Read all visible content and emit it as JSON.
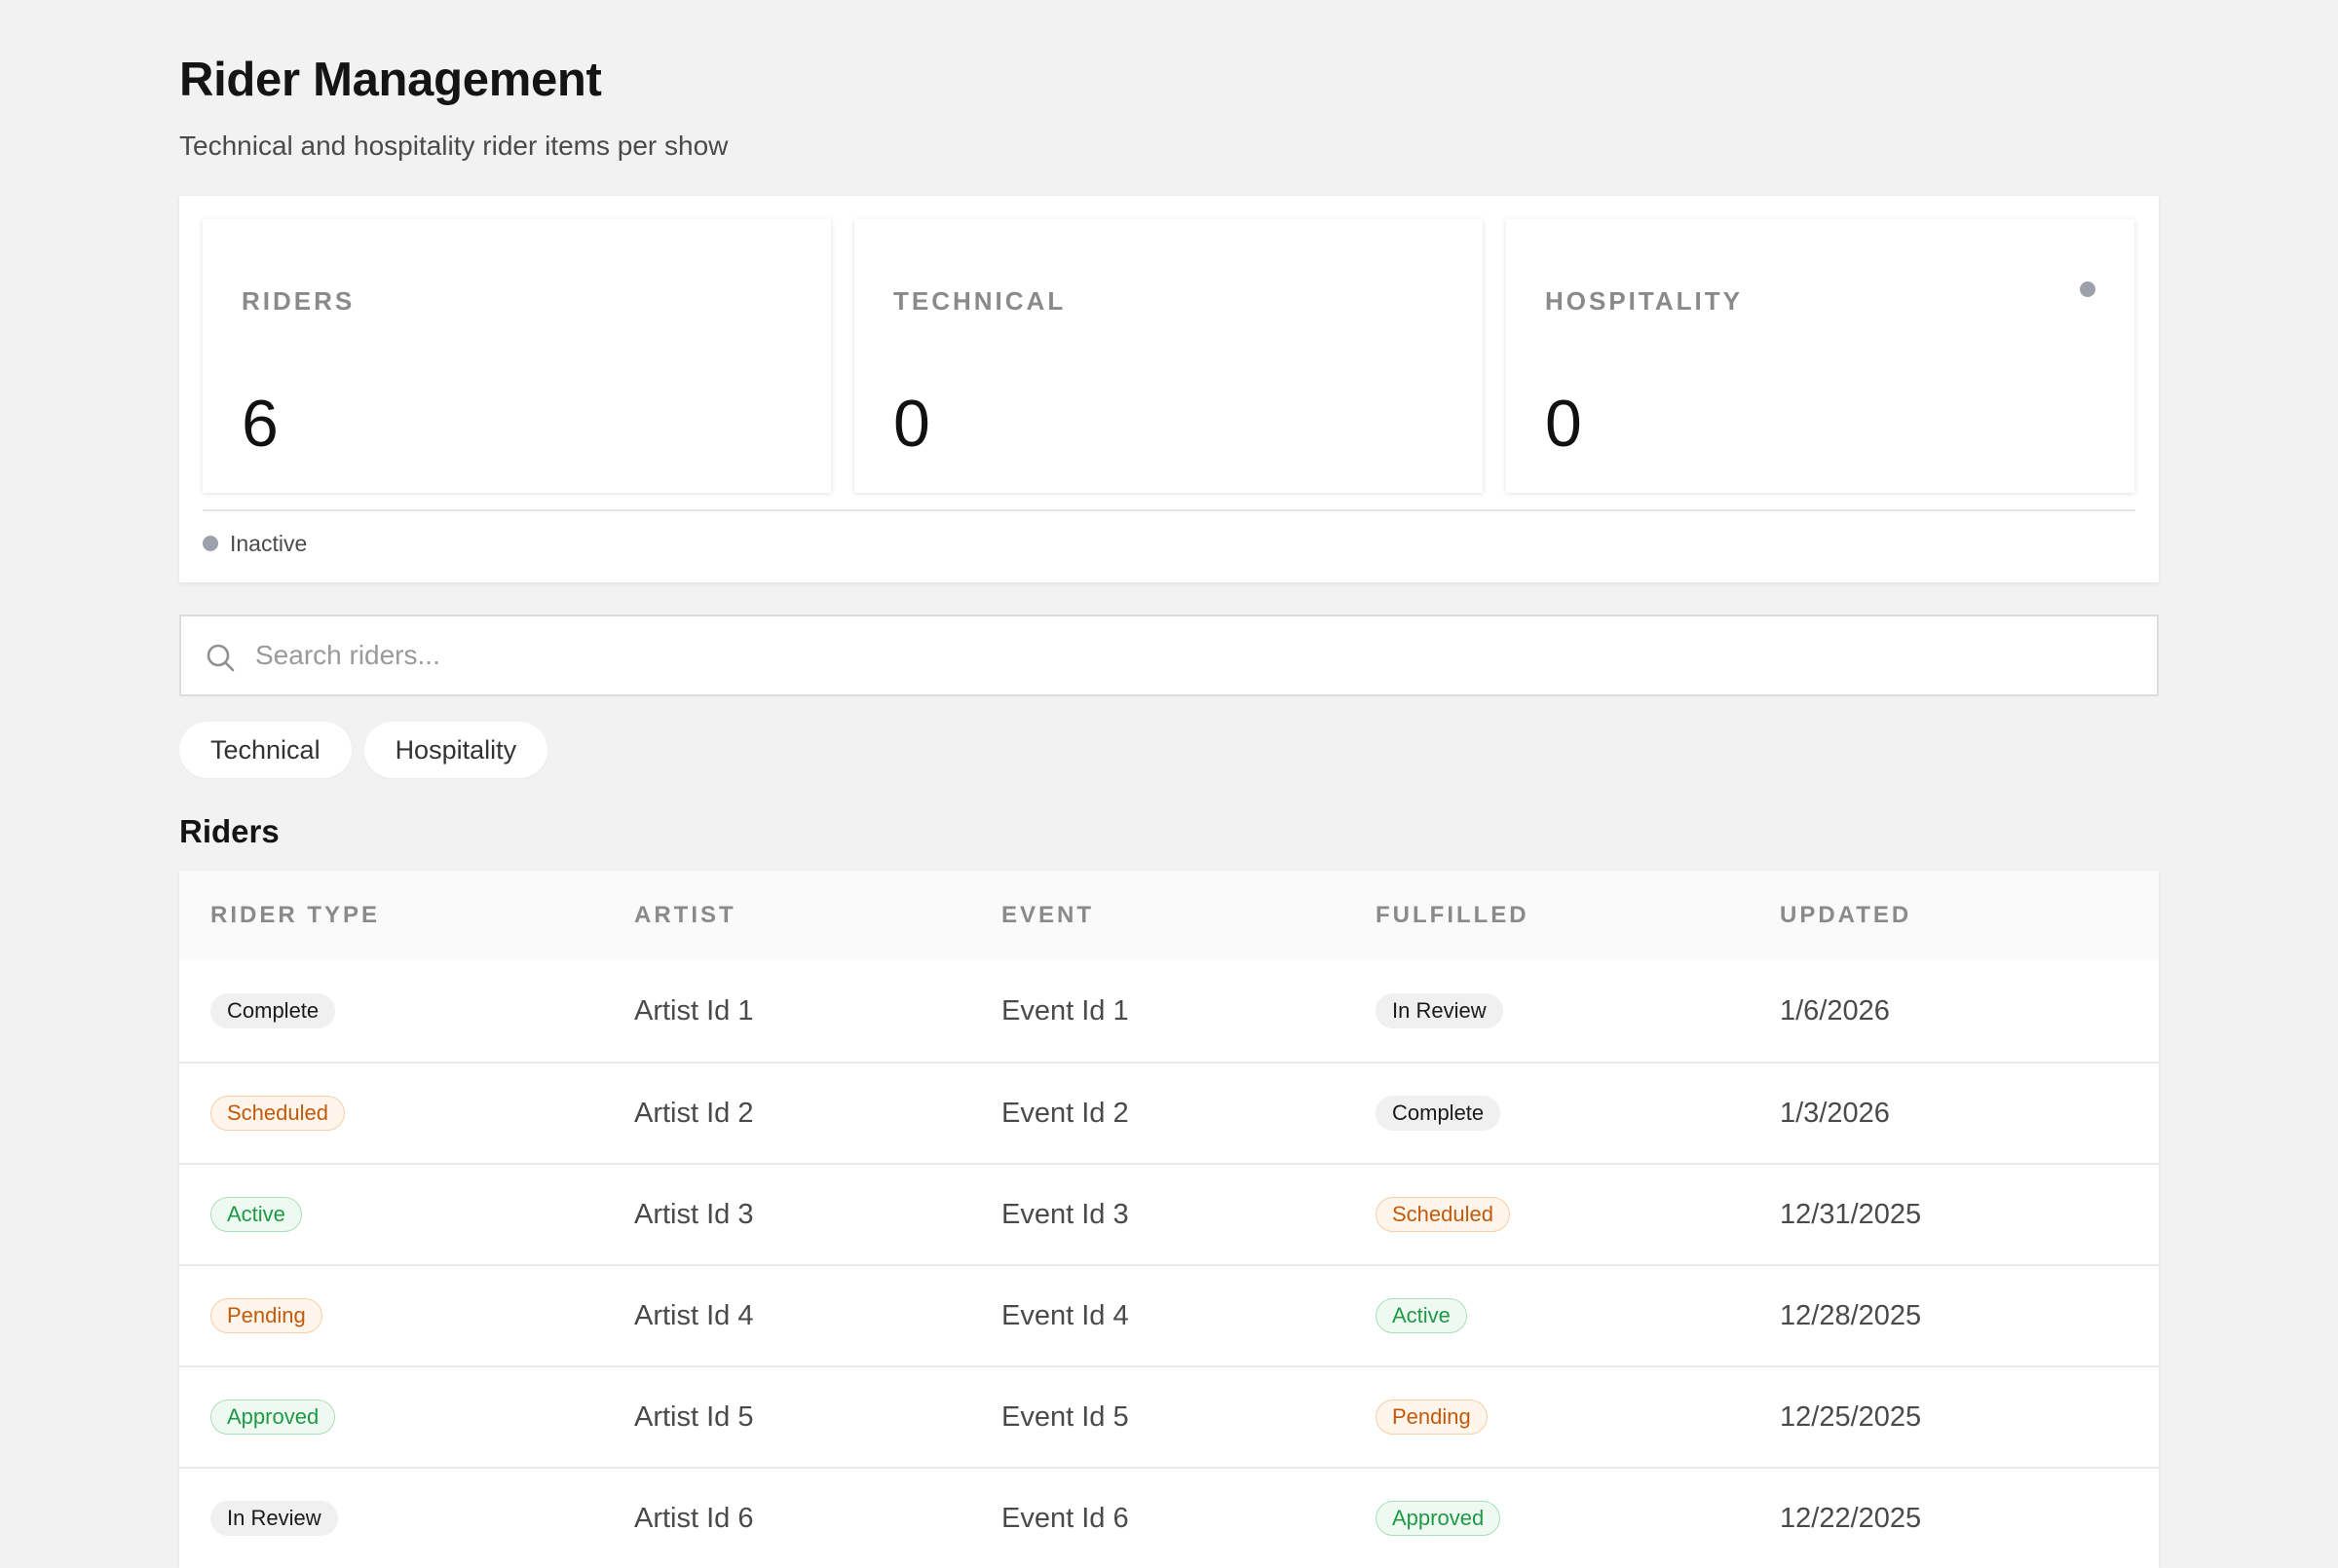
{
  "header": {
    "title": "Rider Management",
    "subtitle": "Technical and hospitality rider items per show"
  },
  "stats": [
    {
      "label": "RIDERS",
      "value": "6"
    },
    {
      "label": "TECHNICAL",
      "value": "0"
    },
    {
      "label": "HOSPITALITY",
      "value": "0"
    }
  ],
  "status": {
    "text": "Inactive",
    "color": "#9ca0aa"
  },
  "search": {
    "placeholder": "Search riders...",
    "value": "",
    "icon": "search-icon"
  },
  "filters": [
    {
      "label": "Technical"
    },
    {
      "label": "Hospitality"
    }
  ],
  "section": {
    "title": "Riders"
  },
  "table": {
    "columns": [
      "RIDER TYPE",
      "ARTIST",
      "EVENT",
      "FULFILLED",
      "UPDATED"
    ],
    "rows": [
      {
        "rider_type": "Complete",
        "rider_type_tone": "neutral",
        "artist": "Artist Id 1",
        "event": "Event Id 1",
        "fulfilled": "In Review",
        "fulfilled_tone": "neutral",
        "updated": "1/6/2026"
      },
      {
        "rider_type": "Scheduled",
        "rider_type_tone": "warn",
        "artist": "Artist Id 2",
        "event": "Event Id 2",
        "fulfilled": "Complete",
        "fulfilled_tone": "neutral",
        "updated": "1/3/2026"
      },
      {
        "rider_type": "Active",
        "rider_type_tone": "success",
        "artist": "Artist Id 3",
        "event": "Event Id 3",
        "fulfilled": "Scheduled",
        "fulfilled_tone": "warn",
        "updated": "12/31/2025"
      },
      {
        "rider_type": "Pending",
        "rider_type_tone": "warn",
        "artist": "Artist Id 4",
        "event": "Event Id 4",
        "fulfilled": "Active",
        "fulfilled_tone": "success",
        "updated": "12/28/2025"
      },
      {
        "rider_type": "Approved",
        "rider_type_tone": "success",
        "artist": "Artist Id 5",
        "event": "Event Id 5",
        "fulfilled": "Pending",
        "fulfilled_tone": "warn",
        "updated": "12/25/2025"
      },
      {
        "rider_type": "In Review",
        "rider_type_tone": "neutral",
        "artist": "Artist Id 6",
        "event": "Event Id 6",
        "fulfilled": "Approved",
        "fulfilled_tone": "success",
        "updated": "12/22/2025"
      }
    ]
  },
  "colors": {
    "background": "#f2f2f2",
    "card": "#ffffff",
    "neutral_badge": "#f0f0f0",
    "warn_text": "#c25a0c",
    "success_text": "#1e9a45"
  }
}
